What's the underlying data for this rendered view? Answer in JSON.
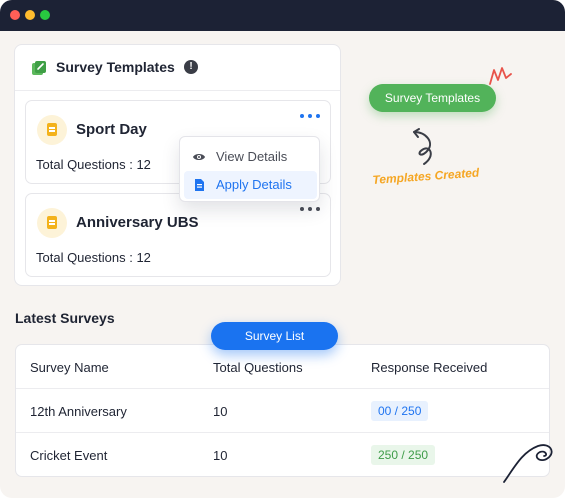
{
  "colors": {
    "titlebar": "#1c2235",
    "accent_blue": "#1a73f0",
    "accent_green": "#52b35a",
    "annotation_orange": "#f5a623",
    "card_icon": "#f3b21b"
  },
  "templates_panel": {
    "title": "Survey Templates",
    "header_icon": "template-icon",
    "info_icon": "info-icon",
    "cards": [
      {
        "title": "Sport Day",
        "questions": "Total Questions : 12",
        "icon": "document-icon"
      },
      {
        "title": "Anniversary UBS",
        "questions": "Total Questions : 12",
        "icon": "document-icon"
      }
    ],
    "menu": [
      {
        "label": "View Details",
        "icon": "eye-icon"
      },
      {
        "label": "Apply Details",
        "icon": "file-icon"
      }
    ]
  },
  "annotations": {
    "templates_pill": "Survey Templates",
    "templates_created": "Templates Created",
    "survey_list_pill": "Survey List"
  },
  "latest_surveys": {
    "title": "Latest Surveys",
    "columns": [
      "Survey Name",
      "Total Questions",
      "Response Received"
    ],
    "rows": [
      {
        "name": "12th Anniversary",
        "questions": "10",
        "response": "00 / 250",
        "status": "blue"
      },
      {
        "name": "Cricket Event",
        "questions": "10",
        "response": "250 / 250",
        "status": "green"
      }
    ]
  }
}
